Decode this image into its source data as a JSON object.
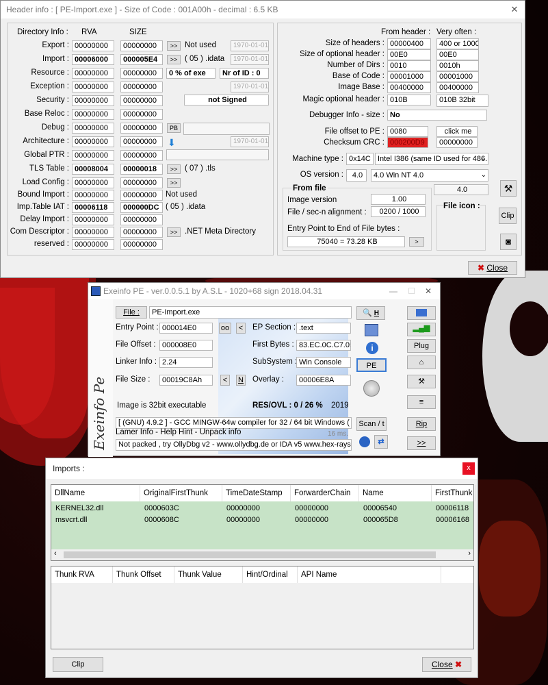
{
  "header_win": {
    "title": "Header info : [ PE-Import.exe ] - Size of Code : 001A00h - decimal : 6.5 KB",
    "cols": {
      "dir": "Directory Info :",
      "rva": "RVA",
      "size": "SIZE"
    },
    "dirs": [
      {
        "name": "Export :",
        "rva": "00000000",
        "size": "00000000",
        "btn": ">>",
        "info": "Not used",
        "date": "1970-01-01",
        "bold": false
      },
      {
        "name": "Import :",
        "rva": "00006000",
        "size": "000005E4",
        "btn": ">>",
        "info": "( 05 ) .idata",
        "date": "1970-01-01",
        "bold": true
      },
      {
        "name": "Resource :",
        "rva": "00000000",
        "size": "00000000"
      },
      {
        "name": "Exception :",
        "rva": "00000000",
        "size": "00000000",
        "date": "1970-01-01"
      },
      {
        "name": "Security :",
        "rva": "00000000",
        "size": "00000000"
      },
      {
        "name": "Base Reloc :",
        "rva": "00000000",
        "size": "00000000"
      },
      {
        "name": "Debug :",
        "rva": "00000000",
        "size": "00000000",
        "btn": "PB"
      },
      {
        "name": "Architecture :",
        "rva": "00000000",
        "size": "00000000",
        "date": "1970-01-01"
      },
      {
        "name": "Global PTR :",
        "rva": "00000000",
        "size": "00000000"
      },
      {
        "name": "TLS Table :",
        "rva": "00008004",
        "size": "00000018",
        "btn": ">>",
        "info": "( 07 ) .tls",
        "bold": true
      },
      {
        "name": "Load Config :",
        "rva": "00000000",
        "size": "00000000",
        "btn": ">>"
      },
      {
        "name": "Bound Import :",
        "rva": "00000000",
        "size": "00000000",
        "info": "Not used"
      },
      {
        "name": "Imp.Table IAT :",
        "rva": "00006118",
        "size": "000000DC",
        "info": "( 05 ) .idata",
        "bold": true
      },
      {
        "name": "Delay Import :",
        "rva": "00000000",
        "size": "00000000"
      },
      {
        "name": "Com Descriptor :",
        "rva": "00000000",
        "size": "00000000",
        "btn": ">>",
        "info": ".NET Meta Directory"
      },
      {
        "name": "reserved :",
        "rva": "00000000",
        "size": "00000000"
      }
    ],
    "resource_pct": "0  % of exe",
    "nr_of_id": "Nr of ID : 0",
    "not_signed": "not Signed",
    "right": {
      "from_header": "From header :",
      "very_often": "Very often :",
      "rows": [
        {
          "label": "Size of headers :",
          "val": "00000400",
          "often": "400 or 1000"
        },
        {
          "label": "Size of optional header :",
          "val": "00E0",
          "often": "00E0"
        },
        {
          "label": "Number of Dirs :",
          "val": "0010",
          "often": "0010h"
        },
        {
          "label": "Base of Code :",
          "val": "00001000",
          "often": "00001000"
        },
        {
          "label": "Image Base :",
          "val": "00400000",
          "often": "00400000"
        },
        {
          "label": "Magic optional header :",
          "val": "010B",
          "often": "010B 32bit"
        }
      ],
      "debugger_label": "Debugger Info  -  size :",
      "debugger_val": "No",
      "offset_pe_label": "File offset to PE :",
      "offset_pe_val": "0080",
      "click_me": "click me",
      "crc_label": "Checksum CRC :",
      "crc_val": "000200D9",
      "crc_often": "00000000",
      "machine_label": "Machine type :",
      "machine_val": "0x14C",
      "machine_desc": "Intel I386 (same ID used for 486...)",
      "os_label": "OS version :",
      "os_val": "4.0",
      "os_desc": "4.0   Win NT 4.0",
      "os_extra": "4.0",
      "from_file": "From file",
      "img_ver_label": "Image version",
      "img_ver_val": "1.00",
      "align_label": "File / sec-n alignment :",
      "align_val": "0200  /  1000",
      "ep_end_label": "Entry Point to End of File bytes :",
      "ep_end_val": "75040  =  73.28 KB",
      "file_icon": "File icon :",
      "clip": "Clip",
      "close": "Close"
    }
  },
  "exeinfo": {
    "title": "Exeinfo PE - ver.0.0.5.1  by A.S.L -  1020+68 sign  2018.04.31",
    "file_btn": "File :",
    "file_val": "PE-Import.exe",
    "ep_label": "Entry Point :",
    "ep_val": "000014E0",
    "oo": "oo",
    "lt": "<",
    "ep_sec_label": "EP Section :",
    "ep_sec_val": ".text",
    "fo_label": "File Offset :",
    "fo_val": "000008E0",
    "fb_label": "First Bytes :",
    "fb_val": "83.EC.0C.C7.05",
    "li_label": "Linker Info :",
    "li_val": "2.24",
    "ss_label": "SubSystem :",
    "ss_val": "Win Console",
    "fs_label": "File Size :",
    "fs_val": "00019C8Ah",
    "n": "N",
    "ov_label": "Overlay :",
    "ov_val": "00006E8A",
    "img32": "Image is 32bit executable",
    "resovl": "RES/OVL : 0 / 26 %",
    "year": "2019",
    "compiler": "[ (GNU) 4.9.2 ] - GCC MINGW-64w compiler for 32 / 64 bit Windows ( exe )",
    "lamer": "Lamer Info - Help Hint - Unpack info",
    "ms": "16 ms.",
    "hint": "Not packed , try OllyDbg v2 - www.ollydbg.de or IDA v5 www.hex-rays.com",
    "pe_btn": "PE",
    "scan_btn": "Scan / t",
    "plug": "Plug",
    "rip": "Rip",
    "next": ">>",
    "h": "H"
  },
  "imports": {
    "title": "Imports :",
    "close_x": "x",
    "headers": [
      "DllName",
      "OriginalFirstThunk",
      "TimeDateStamp",
      "ForwarderChain",
      "Name",
      "FirstThunk"
    ],
    "rows": [
      [
        "KERNEL32.dll",
        "0000603C",
        "00000000",
        "00000000",
        "00006540",
        "00006118"
      ],
      [
        "msvcrt.dll",
        "0000608C",
        "00000000",
        "00000000",
        "000065D8",
        "00006168"
      ]
    ],
    "thunk_headers": [
      "Thunk RVA",
      "Thunk Offset",
      "Thunk Value",
      "Hint/Ordinal",
      "API Name"
    ],
    "clip": "Clip",
    "close": "Close"
  }
}
